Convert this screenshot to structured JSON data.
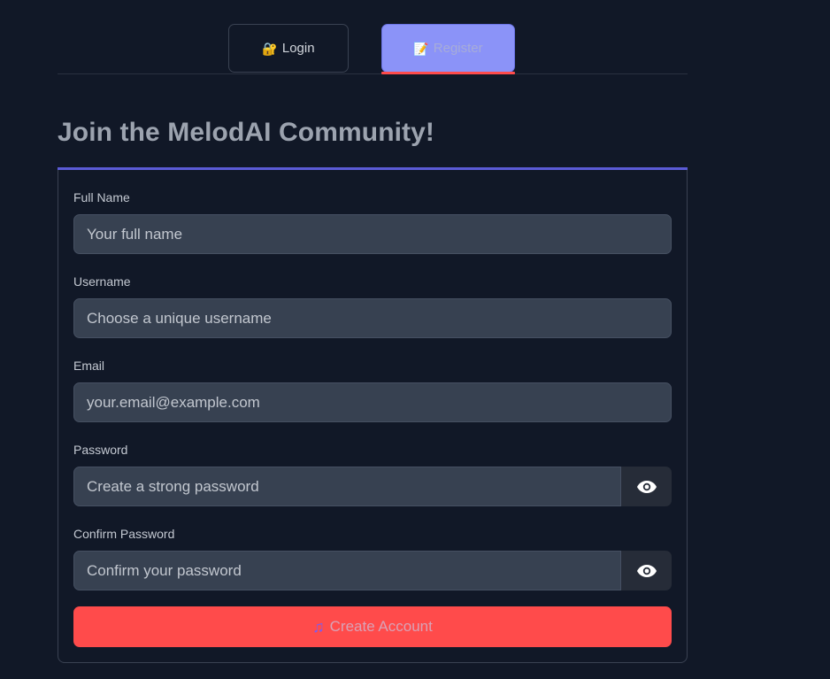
{
  "tabs": {
    "login": {
      "icon": "🔐",
      "icon_name": "lock-icon",
      "label": "Login"
    },
    "register": {
      "icon": "📝",
      "icon_name": "memo-icon",
      "label": "Register"
    }
  },
  "heading": "Join the MelodAI Community!",
  "form": {
    "full_name": {
      "label": "Full Name",
      "placeholder": "Your full name",
      "value": ""
    },
    "username": {
      "label": "Username",
      "placeholder": "Choose a unique username",
      "value": ""
    },
    "email": {
      "label": "Email",
      "placeholder": "your.email@example.com",
      "value": ""
    },
    "password": {
      "label": "Password",
      "placeholder": "Create a strong password",
      "value": "",
      "toggle_icon": "eye-icon"
    },
    "confirm_password": {
      "label": "Confirm Password",
      "placeholder": "Confirm your password",
      "value": "",
      "toggle_icon": "eye-icon"
    },
    "submit": {
      "icon": "♫",
      "icon_name": "music-note-icon",
      "label": "Create Account"
    }
  },
  "colors": {
    "background": "#111827",
    "accent": "#ff4b4b",
    "active_tab": "#8b93f8",
    "heading_rule": "#5b5bd6",
    "input_bg": "#374151"
  }
}
